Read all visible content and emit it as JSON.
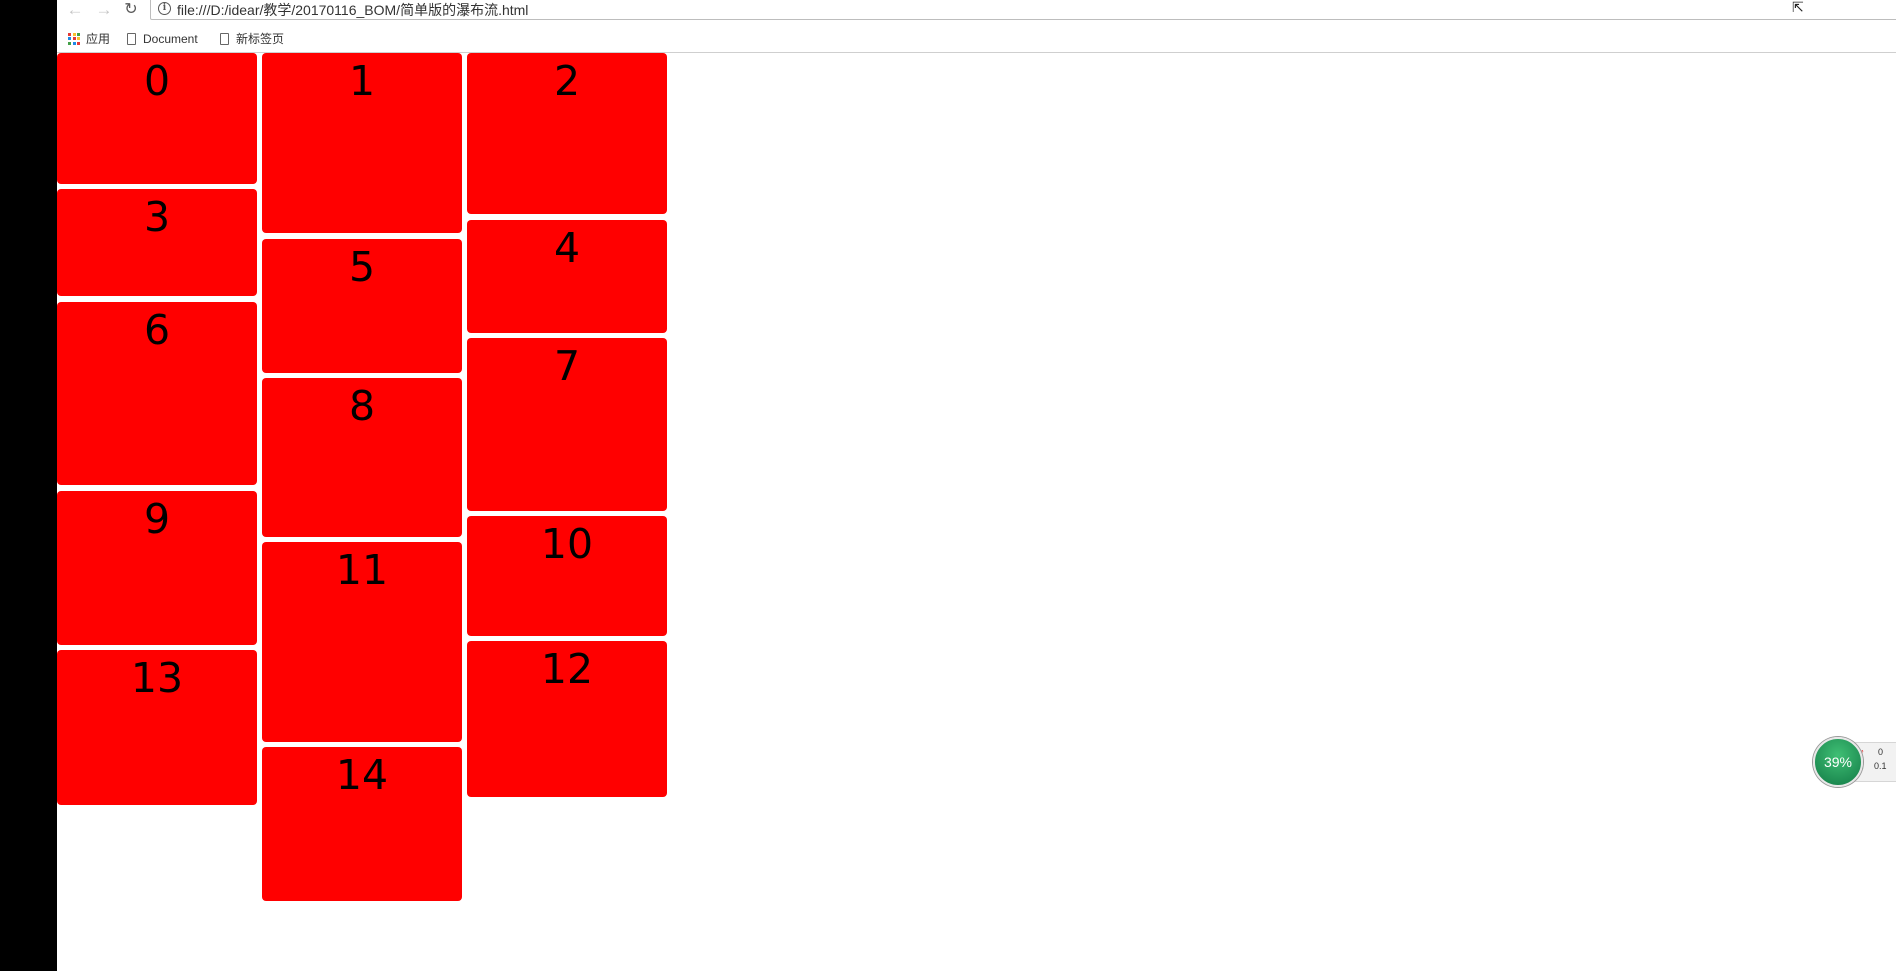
{
  "toolbar": {
    "back_glyph": "←",
    "forward_glyph": "→",
    "reload_glyph": "↻",
    "info_glyph": "i",
    "url": "file:///D:/idear/教学/20170116_BOM/简单版的瀑布流.html"
  },
  "bookmarks": [
    {
      "label": "应用",
      "icon": "apps-grid-icon"
    },
    {
      "label": "Document",
      "icon": "page-icon"
    },
    {
      "label": "新标签页",
      "icon": "page-icon"
    }
  ],
  "waterfall": {
    "box_color": "#ff0000",
    "boxes": [
      {
        "label": "0"
      },
      {
        "label": "1"
      },
      {
        "label": "2"
      },
      {
        "label": "3"
      },
      {
        "label": "4"
      },
      {
        "label": "5"
      },
      {
        "label": "6"
      },
      {
        "label": "7"
      },
      {
        "label": "8"
      },
      {
        "label": "9"
      },
      {
        "label": "10"
      },
      {
        "label": "11"
      },
      {
        "label": "12"
      },
      {
        "label": "13"
      },
      {
        "label": "14"
      }
    ]
  },
  "net_widget": {
    "percent": "39%",
    "up_arrow": "↑",
    "down_arrow": "↓",
    "up_value": "0",
    "down_value": "0.1"
  }
}
